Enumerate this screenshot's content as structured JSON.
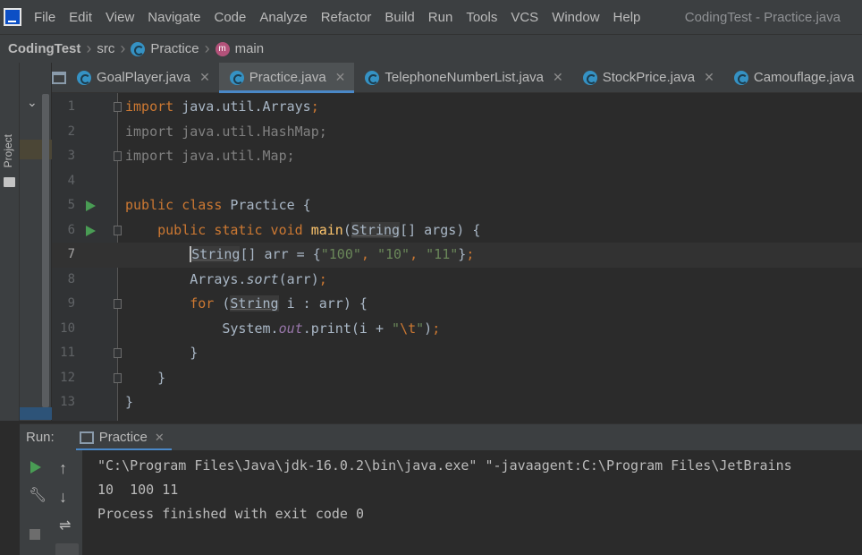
{
  "menu": {
    "items": [
      "File",
      "Edit",
      "View",
      "Navigate",
      "Code",
      "Analyze",
      "Refactor",
      "Build",
      "Run",
      "Tools",
      "VCS",
      "Window",
      "Help"
    ],
    "window_title": "CodingTest - Practice.java"
  },
  "breadcrumb": {
    "project": "CodingTest",
    "folder": "src",
    "class": "Practice",
    "method": "main"
  },
  "side": {
    "project_label": "Project"
  },
  "tabs": [
    {
      "label": "GoalPlayer.java",
      "active": false
    },
    {
      "label": "Practice.java",
      "active": true
    },
    {
      "label": "TelephoneNumberList.java",
      "active": false
    },
    {
      "label": "StockPrice.java",
      "active": false
    },
    {
      "label": "Camouflage.java",
      "active": false
    }
  ],
  "editor": {
    "current_line": 7,
    "lines": [
      {
        "n": "1",
        "text": "import java.util.Arrays;"
      },
      {
        "n": "2",
        "text": "import java.util.HashMap;"
      },
      {
        "n": "3",
        "text": "import java.util.Map;"
      },
      {
        "n": "4",
        "text": ""
      },
      {
        "n": "5",
        "text": "public class Practice {"
      },
      {
        "n": "6",
        "text": "    public static void main(String[] args) {"
      },
      {
        "n": "7",
        "text": "        String[] arr = {\"100\", \"10\", \"11\"};"
      },
      {
        "n": "8",
        "text": "        Arrays.sort(arr);"
      },
      {
        "n": "9",
        "text": "        for (String i : arr) {"
      },
      {
        "n": "10",
        "text": "            System.out.print(i + \"\\t\");"
      },
      {
        "n": "11",
        "text": "        }"
      },
      {
        "n": "12",
        "text": "    }"
      },
      {
        "n": "13",
        "text": "}"
      }
    ]
  },
  "run_panel": {
    "title": "Run:",
    "tab_label": "Practice",
    "output": [
      "\"C:\\Program Files\\Java\\jdk-16.0.2\\bin\\java.exe\" \"-javaagent:C:\\Program Files\\JetBrains",
      "10  100 11",
      "Process finished with exit code 0"
    ]
  },
  "colors": {
    "keyword": "#cc7832",
    "string": "#6a8759",
    "method_decl": "#ffc66d",
    "static_field": "#9876aa",
    "accent": "#4a88c7",
    "run_green": "#499c54"
  }
}
